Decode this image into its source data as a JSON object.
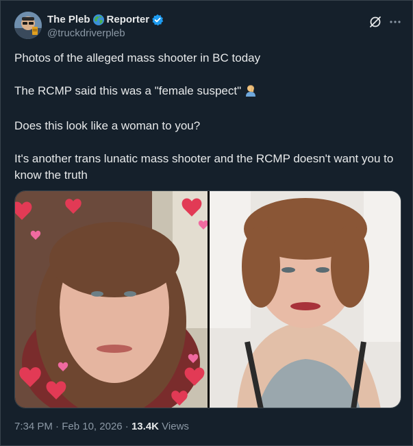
{
  "author": {
    "display_name_first": "The Pleb",
    "display_name_second": "Reporter",
    "handle": "@truckdriverpleb",
    "verified_color": "#1d9bf0",
    "avatar_icon": "avatar-photo",
    "globe_icon": "globe-emoji"
  },
  "tweet": {
    "paragraphs": [
      "Photos of the alleged mass shooter in BC today",
      "The RCMP said this was a \"female suspect\"",
      "Does this look like a woman to you?",
      "It's another trans lunatic mass shooter and the RCMP doesn't want you to know the truth"
    ],
    "emoji_icon": "man-facepalming-emoji"
  },
  "meta": {
    "time": "7:34 PM",
    "separator": "·",
    "date": "Feb 10, 2026",
    "views_count": "13.4K",
    "views_label": "Views"
  },
  "colors": {
    "background": "#15202b",
    "text": "#e7e9ea",
    "secondary_text": "#8b98a5",
    "border": "#38444d"
  }
}
